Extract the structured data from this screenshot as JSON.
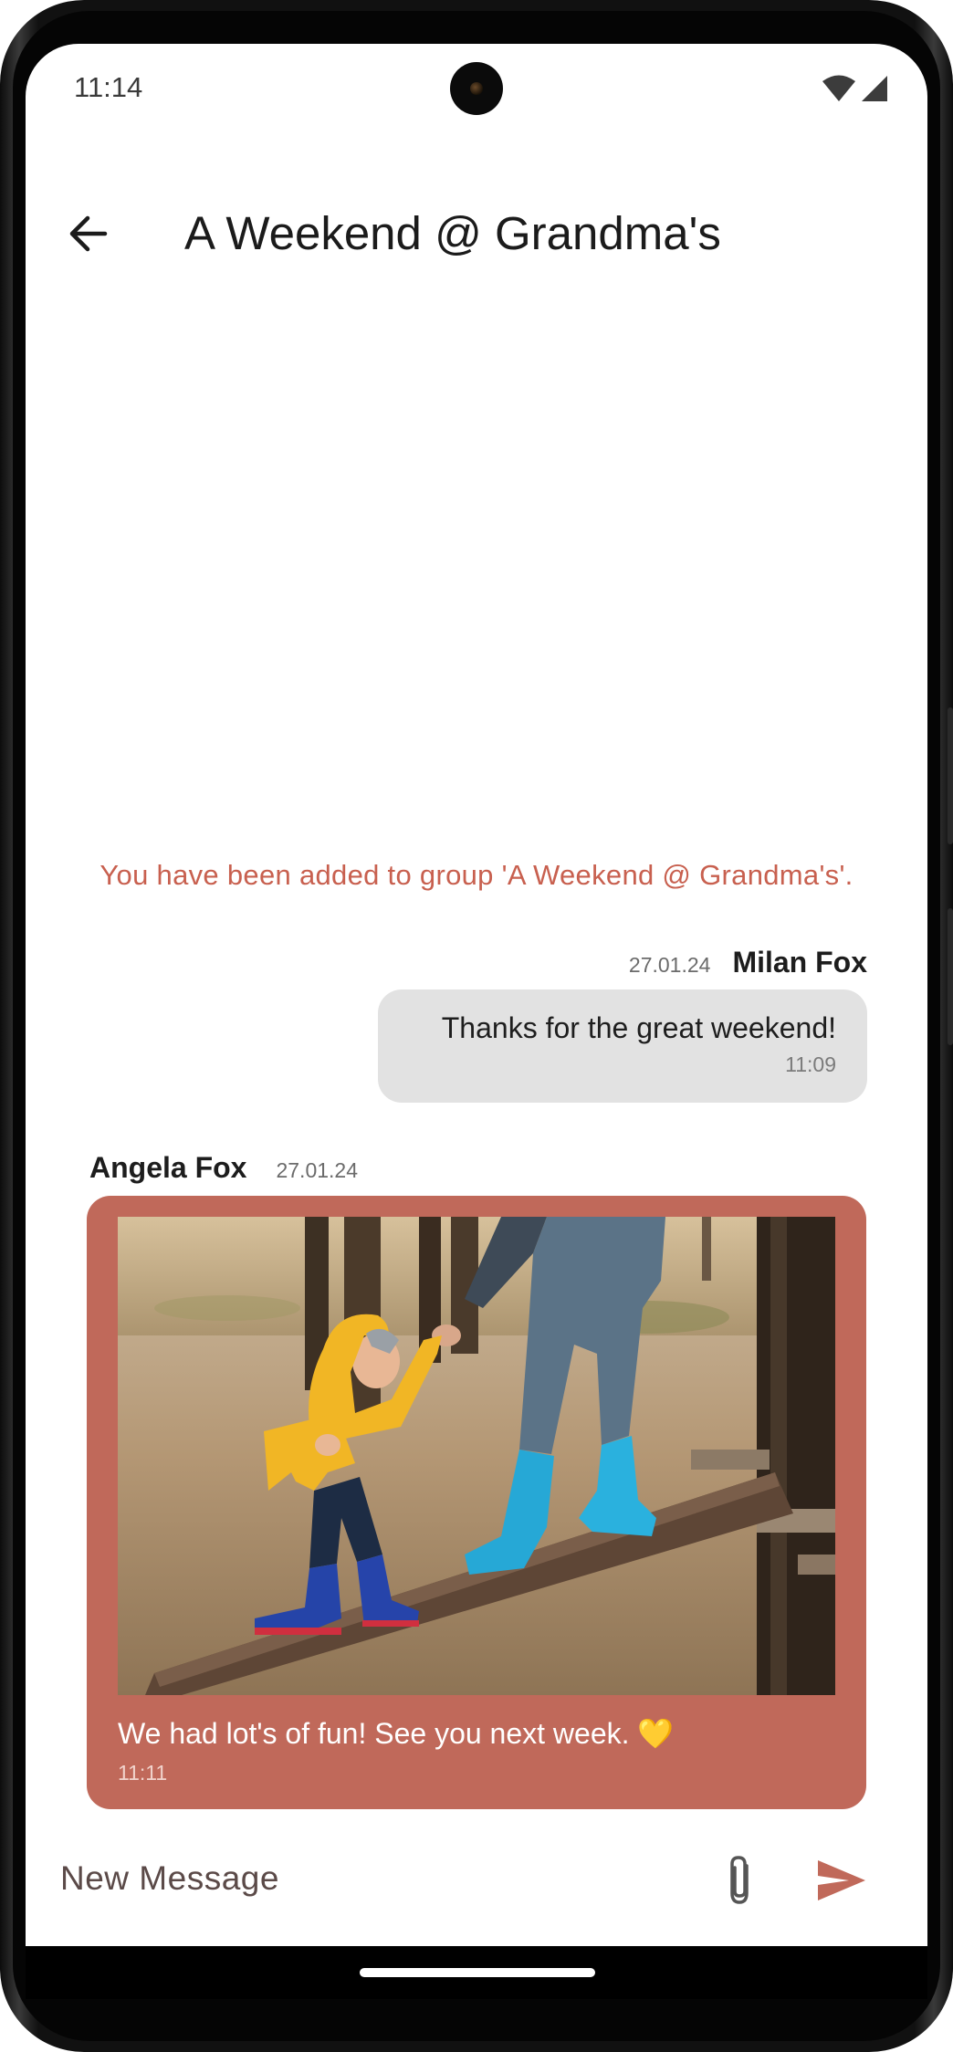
{
  "status_bar": {
    "time": "11:14"
  },
  "header": {
    "title": "A Weekend @ Grandma's",
    "back_icon": "arrow-left-icon"
  },
  "chat": {
    "system_message": "You have been added to group 'A Weekend @ Grandma's'.",
    "messages": [
      {
        "direction": "outgoing",
        "sender": "Milan Fox",
        "date": "27.01.24",
        "text": "Thanks for the great weekend!",
        "time": "11:09"
      },
      {
        "direction": "incoming",
        "sender": "Angela Fox",
        "date": "27.01.24",
        "has_photo": true,
        "text": "We had lot's of fun! See you next week. 💛",
        "time": "11:11"
      }
    ]
  },
  "composer": {
    "placeholder": "New Message",
    "attach_icon": "paperclip-icon",
    "send_icon": "send-icon"
  },
  "colors": {
    "accent": "#c0695a",
    "system_text": "#c8604f",
    "outgoing_bubble": "#e2e2e2"
  }
}
